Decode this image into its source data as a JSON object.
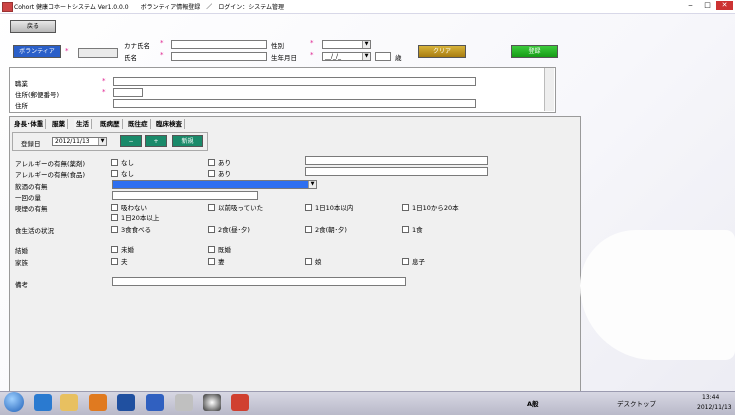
{
  "window": {
    "title": "Cohort 健康コホートシステム Ver1.0.0.0　　ボランティア情報登録　／　ログイン：システム管理",
    "min": "‒",
    "max": "□",
    "close": "✕"
  },
  "toolbar": {
    "back_label": "戻る"
  },
  "header": {
    "volunteer_label": "ボランティア",
    "star": "*",
    "kana_label": "カナ氏名",
    "name_label": "氏名",
    "gender_label": "性別",
    "birth_label": "生年月日",
    "birth_placeholder": "__/_/_",
    "age_suffix": "歳",
    "clear_label": "クリア",
    "register_label": "登録"
  },
  "upper": {
    "job_label": "職業",
    "address_label": "住所(郵便番号)",
    "address2_label": "住所",
    "phone_label": "電話番号"
  },
  "tabs": [
    "身長･体重",
    "服薬",
    "生活",
    "既病歴",
    "既往症",
    "臨床検査"
  ],
  "active_tab": 2,
  "entry": {
    "date_label": "登録日",
    "date_value": "2012/11/13",
    "minus": "−",
    "plus": "+",
    "new_label": "新規"
  },
  "rows": [
    {
      "label": "アレルギーの有無(薬剤)",
      "opts": [
        "なし",
        "あり"
      ]
    },
    {
      "label": "アレルギーの有無(食品)",
      "opts": [
        "なし",
        "あり"
      ]
    },
    {
      "label": "飲酒の有無"
    },
    {
      "label": "一回の量"
    },
    {
      "label": "喫煙の有無",
      "opts": [
        "吸わない",
        "以前吸っていた",
        "1日10本以内",
        "1日10から20本",
        "1日20本以上"
      ]
    },
    {
      "label": "食生活の状況",
      "opts": [
        "3食食べる",
        "2食(昼･夕)",
        "2食(朝･夕)",
        "1食"
      ]
    },
    {
      "label": "結婚",
      "opts": [
        "未婚",
        "既婚"
      ]
    },
    {
      "label": "家族",
      "opts": [
        "夫",
        "妻",
        "娘",
        "息子"
      ]
    },
    {
      "label": "備考"
    }
  ],
  "tray": {
    "ime": "A般",
    "desktop": "デスクトップ",
    "time": "13:44",
    "date": "2012/11/13"
  }
}
